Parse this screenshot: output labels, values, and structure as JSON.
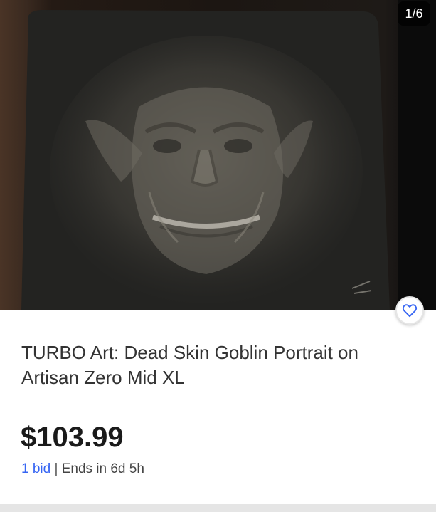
{
  "gallery": {
    "counter": "1/6"
  },
  "listing": {
    "title": "TURBO Art: Dead Skin Goblin Portrait on Artisan Zero Mid XL",
    "price": "$103.99",
    "bids_label": "1 bid",
    "separator": "|",
    "ends_label": "Ends in 6d 5h"
  },
  "icons": {
    "watch": "heart-icon"
  },
  "colors": {
    "link": "#3665f3",
    "heart_stroke": "#3665f3",
    "price_text": "#1a1a1a"
  }
}
